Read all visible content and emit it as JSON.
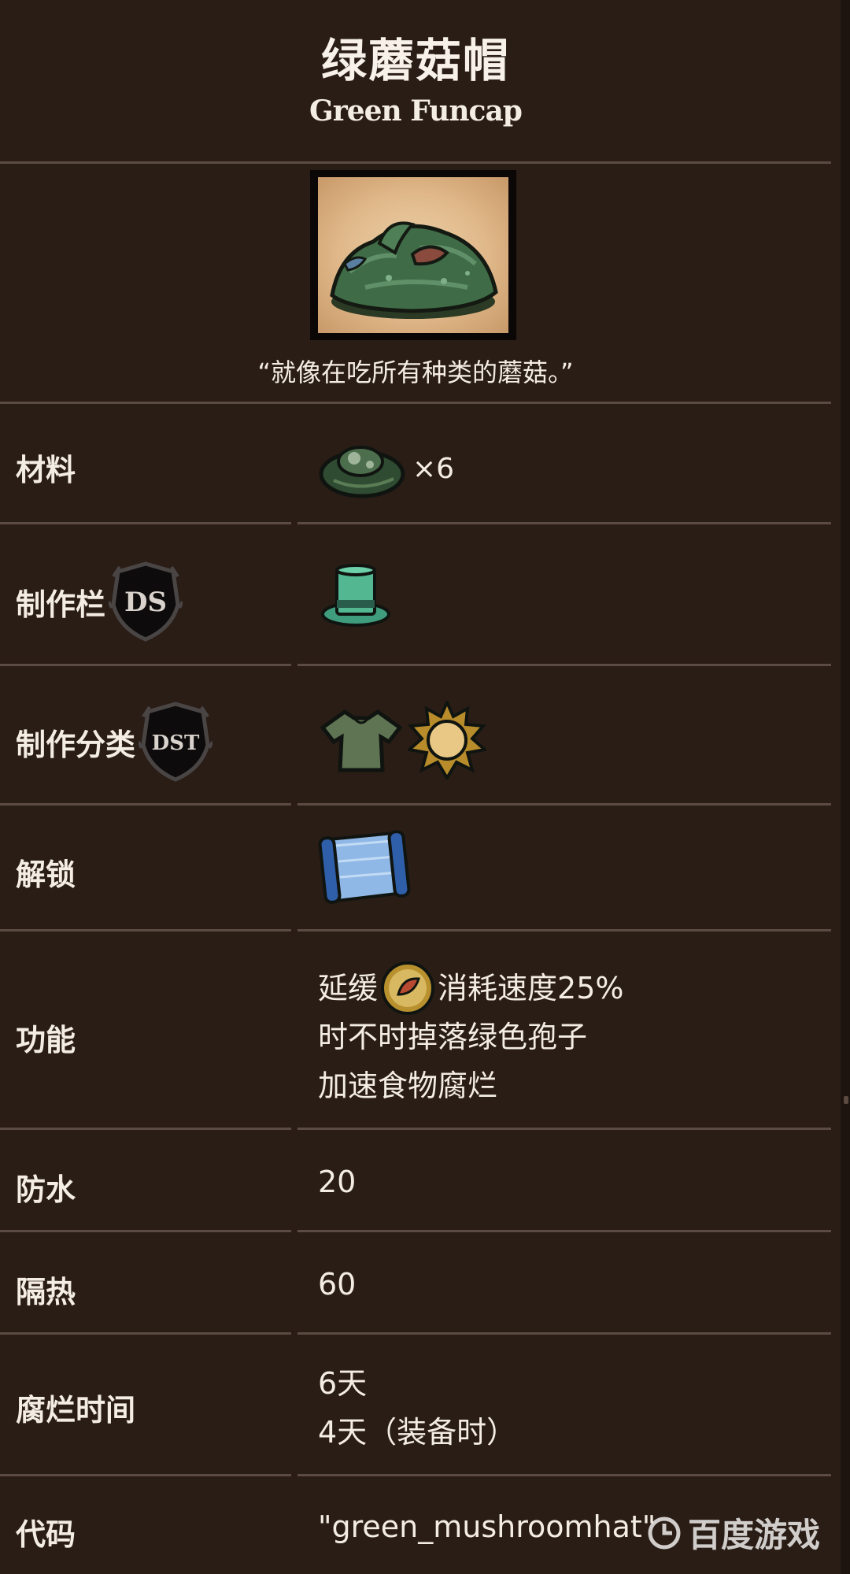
{
  "header": {
    "title": "绿蘑菇帽",
    "subtitle": "Green Funcap"
  },
  "item": {
    "icon": "green-mushroom-hat-icon",
    "quote": "“就像在吃所有种类的蘑菇。”"
  },
  "rows": {
    "materials": {
      "label": "材料",
      "icon": "green-cap-icon",
      "count": "×6"
    },
    "craft_tab": {
      "label": "制作栏",
      "badge": "DS",
      "icon": "dress-tab-tophat-icon"
    },
    "craft_category": {
      "label": "制作分类",
      "badge": "DST",
      "icons": [
        "clothing-icon",
        "summer-sun-icon"
      ]
    },
    "unlock": {
      "label": "解锁",
      "icon": "blueprint-icon"
    },
    "function": {
      "label": "功能",
      "line1_prefix": "延缓",
      "line1_icon": "hunger-icon",
      "line1_suffix": "消耗速度25%",
      "line2": "时不时掉落绿色孢子",
      "line3": "加速食物腐烂"
    },
    "waterproof": {
      "label": "防水",
      "value": "20"
    },
    "insulation": {
      "label": "隔热",
      "value": "60"
    },
    "spoil_time": {
      "label": "腐烂时间",
      "line1": "6天",
      "line2": "4天（装备时）"
    },
    "code": {
      "label": "代码",
      "value": "\"green_mushroomhat\""
    }
  },
  "watermark": {
    "text": "百度游戏"
  },
  "colors": {
    "background": "#2a1d16",
    "divider": "#5c4b42",
    "text": "#f4ede4"
  }
}
